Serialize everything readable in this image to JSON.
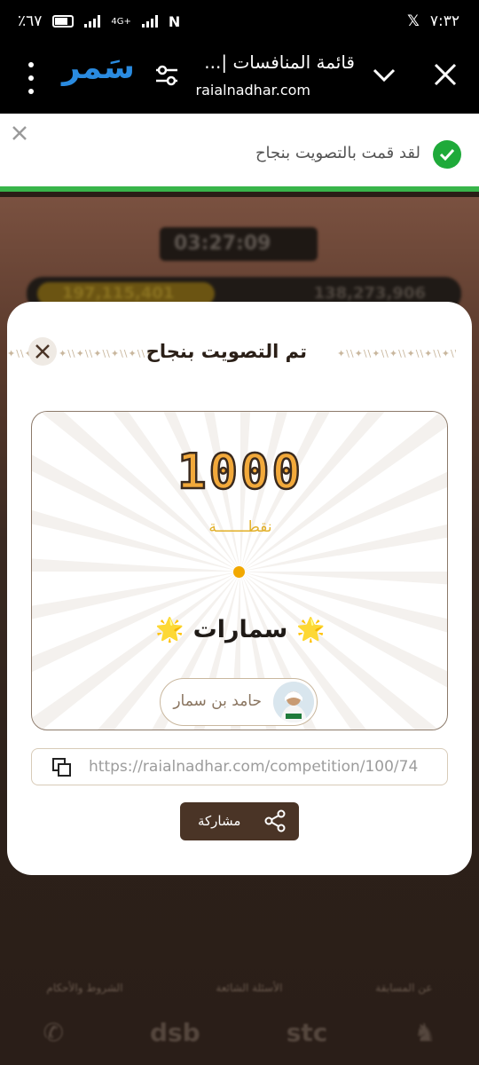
{
  "status_bar": {
    "time": "٧:٣٢",
    "battery": "٪٦٧",
    "network": "4G+"
  },
  "browser": {
    "page_title": "قائمة المنافسات |...",
    "url": "raialnadhar.com",
    "brand": "سَمر"
  },
  "toast": {
    "message": "لقد قمت بالتصويت بنجاح",
    "progress": 1.0
  },
  "background": {
    "timer": "03:27:09",
    "counter_left": "197,115,401",
    "counter_right": "138,273,906",
    "footer_links": [
      "عن المسابقة",
      "الأسئلة الشائعة",
      "الشروط والأحكام"
    ],
    "sponsors": [
      "stc",
      "dsb"
    ]
  },
  "modal": {
    "title": "تم التصويت بنجاح",
    "points_value": "1000",
    "points_unit": "نقطـــــــة",
    "contestant_name": "سمارات",
    "author_name": "حامد بن سمار",
    "share_link": "https://raialnadhar.com/competition/100/74",
    "share_label": "مشاركة",
    "star_glyph": "🌟"
  },
  "colors": {
    "accent_brown": "#4a3426",
    "points_gold": "#f2a93b",
    "success_green": "#1faa3a",
    "brand_blue": "#2a8be0"
  }
}
